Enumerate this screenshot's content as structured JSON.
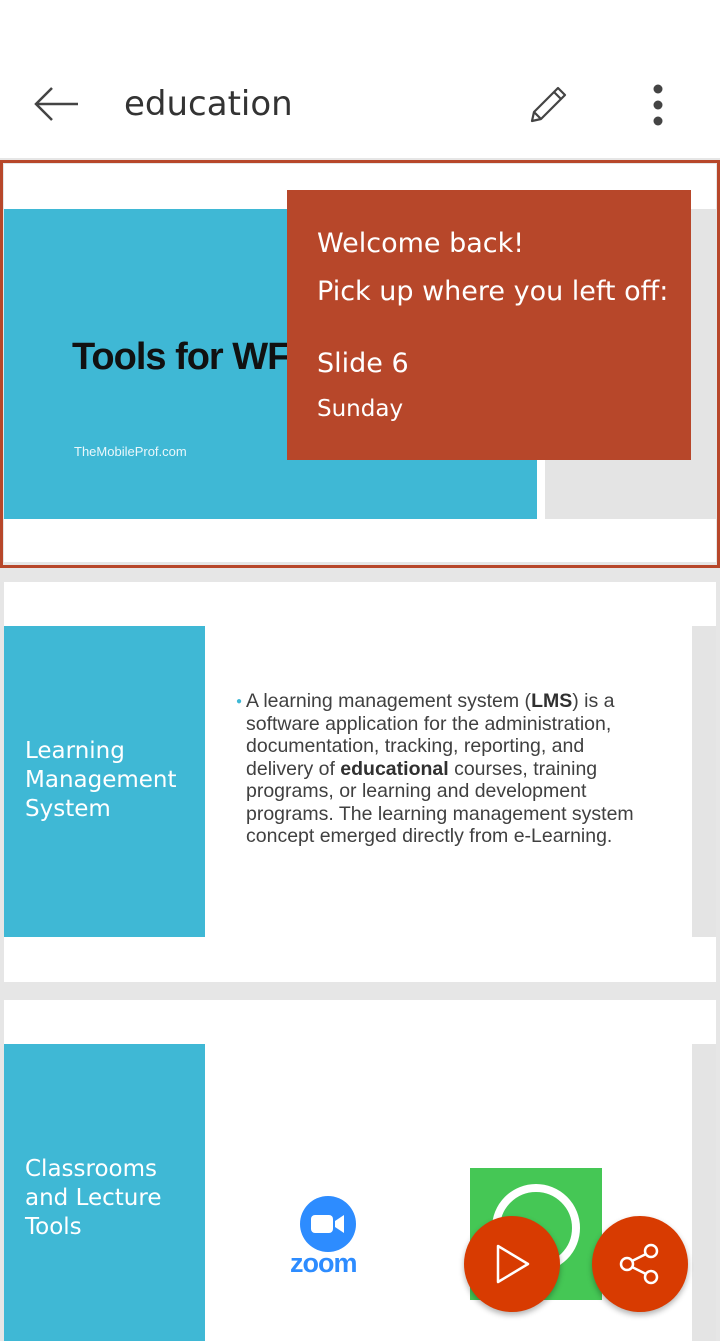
{
  "header": {
    "title": "education",
    "back_icon": "arrow-left-icon",
    "edit_icon": "pencil-icon",
    "more_icon": "more-vertical-icon"
  },
  "slides": [
    {
      "title": "Tools for WF",
      "subtitle": "TheMobileProf.com"
    },
    {
      "sidebar": "Learning Management System",
      "sidebar_lines": [
        "Learning",
        "Management",
        "System"
      ],
      "body_parts": [
        "A learning management system (",
        "LMS",
        ") is a software application for the administration, documentation, tracking, reporting, and delivery of ",
        "educational",
        " courses, training programs, or learning and development programs. The learning management system concept emerged directly from e-Learning."
      ]
    },
    {
      "sidebar": "Classrooms and Lecture Tools",
      "sidebar_lines": [
        "Classrooms",
        "and Lecture",
        "Tools"
      ],
      "zoom_logo_text": "zoom"
    }
  ],
  "popup": {
    "title": "Welcome back!",
    "subtitle": "Pick up where you left off:",
    "slide": "Slide 6",
    "day": "Sunday"
  },
  "fabs": {
    "play_icon": "play-icon",
    "share_icon": "share-icon"
  },
  "colors": {
    "accent": "#b7472a",
    "fab": "#d83b01",
    "slide_blue": "#3fb8d5",
    "zoom_blue": "#2d8cff",
    "whatsapp_green": "#45c755"
  }
}
